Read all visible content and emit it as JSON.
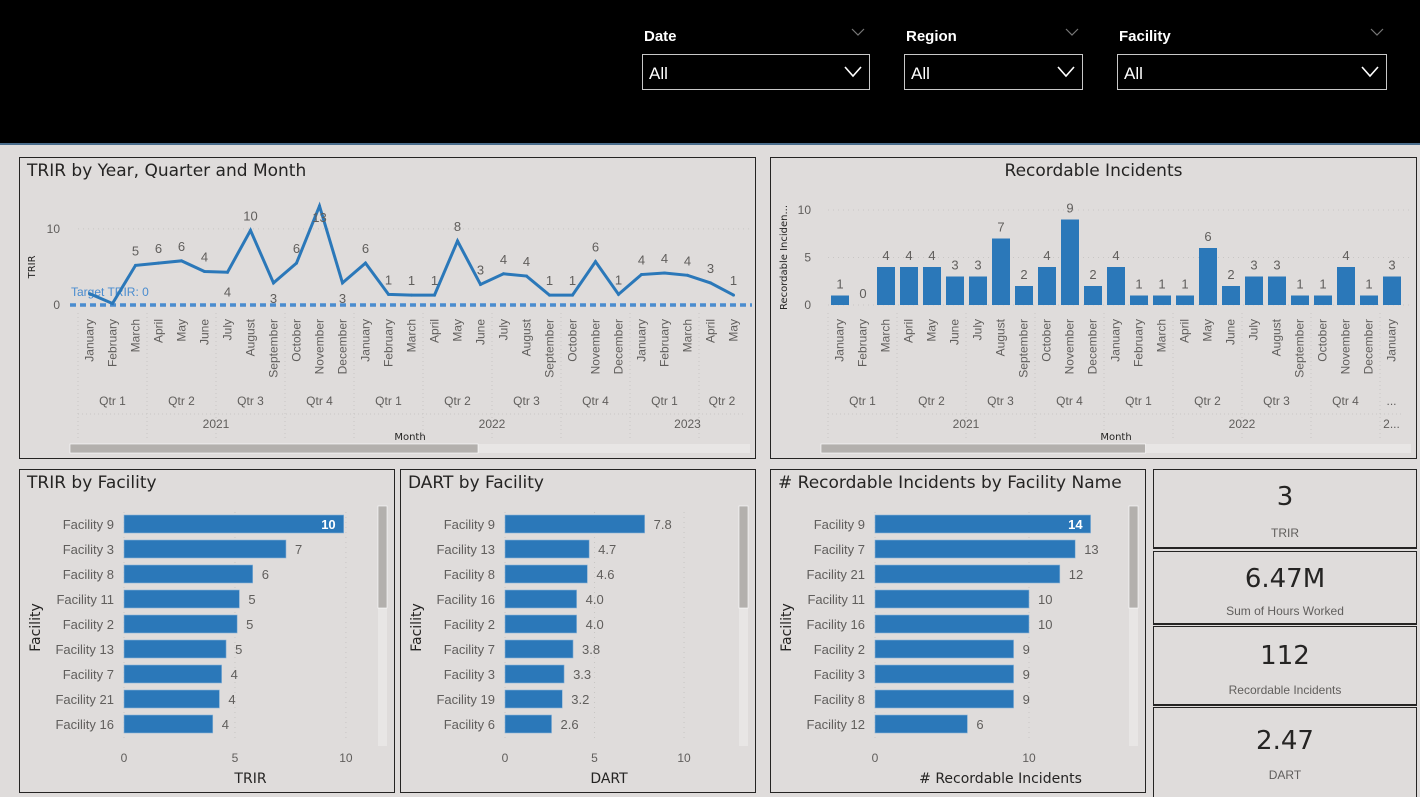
{
  "filters": [
    {
      "label": "Date",
      "value": "All"
    },
    {
      "label": "Region",
      "value": "All"
    },
    {
      "label": "Facility",
      "value": "All"
    }
  ],
  "colors": {
    "bar": "#2b78b9",
    "line": "#2b78b9",
    "target": "#4a8ccf",
    "panel_bg": "#dfdcdb",
    "header_bg": "#000000"
  },
  "trir_trend": {
    "title": "TRIR by Year, Quarter and Month",
    "ylabel": "TRIR",
    "xlabel": "Month",
    "target_label": "Target TRIR: 0",
    "scroll_fraction": 0.6
  },
  "incidents_trend": {
    "title": "Recordable Incidents",
    "ylabel": "Recordable Inciden...",
    "xlabel": "Month",
    "scroll_fraction": 0.55
  },
  "trir_facility": {
    "title": "TRIR by Facility",
    "xlabel": "TRIR",
    "ylabel": "Facility"
  },
  "dart_facility": {
    "title": "DART by Facility",
    "xlabel": "DART",
    "ylabel": "Facility"
  },
  "incidents_facility": {
    "title": "# Recordable Incidents by Facility Name",
    "xlabel": "# Recordable Incidents",
    "ylabel": "Facility"
  },
  "cards": [
    {
      "value": "3",
      "label": "TRIR"
    },
    {
      "value": "6.47M",
      "label": "Sum of  Hours Worked"
    },
    {
      "value": "112",
      "label": "Recordable Incidents"
    },
    {
      "value": "2.47",
      "label": "DART"
    }
  ],
  "chart_data": [
    {
      "type": "line",
      "title": "TRIR by Year, Quarter and Month",
      "xlabel": "Month",
      "ylabel": "TRIR",
      "ylim": [
        0,
        13
      ],
      "yticks": [
        0,
        10
      ],
      "x": [
        "January",
        "February",
        "March",
        "April",
        "May",
        "June",
        "July",
        "August",
        "September",
        "October",
        "November",
        "December",
        "January",
        "February",
        "March",
        "April",
        "May",
        "June",
        "July",
        "August",
        "September",
        "October",
        "November",
        "December",
        "January",
        "February",
        "March",
        "April",
        "May"
      ],
      "quarters": [
        {
          "label": "Qtr 1",
          "span": 3
        },
        {
          "label": "Qtr 2",
          "span": 3
        },
        {
          "label": "Qtr 3",
          "span": 3
        },
        {
          "label": "Qtr 4",
          "span": 3
        },
        {
          "label": "Qtr 1",
          "span": 3
        },
        {
          "label": "Qtr 2",
          "span": 3
        },
        {
          "label": "Qtr 3",
          "span": 3
        },
        {
          "label": "Qtr 4",
          "span": 3
        },
        {
          "label": "Qtr 1",
          "span": 3
        },
        {
          "label": "Qtr 2",
          "span": 2
        }
      ],
      "years": [
        {
          "label": "2021",
          "span": 12
        },
        {
          "label": "2022",
          "span": 12
        },
        {
          "label": "2023",
          "span": 5
        }
      ],
      "values": [
        1.5,
        0.2,
        5.2,
        5.5,
        5.8,
        4.4,
        4.3,
        9.8,
        2.9,
        5.5,
        13,
        2.9,
        5.5,
        1.4,
        1.3,
        1.3,
        8.4,
        2.7,
        4.1,
        3.8,
        1.3,
        1.3,
        5.7,
        1.4,
        4.0,
        4.2,
        3.9,
        2.9,
        1.3
      ],
      "labels": [
        "",
        "",
        "5",
        "6",
        "6",
        "4",
        "4",
        "10",
        "3",
        "6",
        "13",
        "3",
        "6",
        "1",
        "1",
        "1",
        "8",
        "3",
        "4",
        "4",
        "1",
        "1",
        "6",
        "1",
        "4",
        "4",
        "4",
        "3",
        "1"
      ],
      "target": {
        "label": "Target TRIR: 0",
        "value": 0
      }
    },
    {
      "type": "bar",
      "title": "Recordable Incidents",
      "xlabel": "Month",
      "ylabel": "Recordable Inciden...",
      "ylim": [
        0,
        10
      ],
      "yticks": [
        0,
        5,
        10
      ],
      "categories": [
        "January",
        "February",
        "March",
        "April",
        "May",
        "June",
        "July",
        "August",
        "September",
        "October",
        "November",
        "December",
        "January",
        "February",
        "March",
        "April",
        "May",
        "June",
        "July",
        "August",
        "September",
        "October",
        "November",
        "December",
        "January"
      ],
      "quarters": [
        {
          "label": "Qtr 1",
          "span": 3
        },
        {
          "label": "Qtr 2",
          "span": 3
        },
        {
          "label": "Qtr 3",
          "span": 3
        },
        {
          "label": "Qtr 4",
          "span": 3
        },
        {
          "label": "Qtr 1",
          "span": 3
        },
        {
          "label": "Qtr 2",
          "span": 3
        },
        {
          "label": "Qtr 3",
          "span": 3
        },
        {
          "label": "Qtr 4",
          "span": 3
        },
        {
          "label": "...",
          "span": 1
        }
      ],
      "years": [
        {
          "label": "2021",
          "span": 12
        },
        {
          "label": "2022",
          "span": 12
        },
        {
          "label": "2...",
          "span": 1
        }
      ],
      "values": [
        1,
        0,
        4,
        4,
        4,
        3,
        3,
        7,
        2,
        4,
        9,
        2,
        4,
        1,
        1,
        1,
        6,
        2,
        3,
        3,
        1,
        1,
        4,
        1,
        3
      ]
    },
    {
      "type": "bar",
      "orientation": "horizontal",
      "title": "TRIR by Facility",
      "xlabel": "TRIR",
      "ylabel": "Facility",
      "xlim": [
        0,
        10.5
      ],
      "xticks": [
        0,
        5,
        10
      ],
      "categories": [
        "Facility 9",
        "Facility 3",
        "Facility 8",
        "Facility 11",
        "Facility 2",
        "Facility 13",
        "Facility 7",
        "Facility 21",
        "Facility 16"
      ],
      "values": [
        9.9,
        7.3,
        5.8,
        5.2,
        5.1,
        4.6,
        4.4,
        4.3,
        4.0
      ],
      "labels": [
        "10",
        "7",
        "6",
        "5",
        "5",
        "5",
        "4",
        "4",
        "4"
      ]
    },
    {
      "type": "bar",
      "orientation": "horizontal",
      "title": "DART by Facility",
      "xlabel": "DART",
      "ylabel": "Facility",
      "xlim": [
        0,
        10.5
      ],
      "xticks": [
        0,
        5,
        10
      ],
      "categories": [
        "Facility 9",
        "Facility 13",
        "Facility 8",
        "Facility 16",
        "Facility 2",
        "Facility 7",
        "Facility 3",
        "Facility 19",
        "Facility 6"
      ],
      "values": [
        7.8,
        4.7,
        4.6,
        4.0,
        4.0,
        3.8,
        3.3,
        3.2,
        2.6
      ],
      "labels": [
        "7.8",
        "4.7",
        "4.6",
        "4.0",
        "4.0",
        "3.8",
        "3.3",
        "3.2",
        "2.6"
      ]
    },
    {
      "type": "bar",
      "orientation": "horizontal",
      "title": "# Recordable Incidents by Facility Name",
      "xlabel": "# Recordable Incidents",
      "ylabel": "Facility",
      "xlim": [
        0,
        15
      ],
      "xticks": [
        0,
        10
      ],
      "categories": [
        "Facility 9",
        "Facility 7",
        "Facility 21",
        "Facility 11",
        "Facility 16",
        "Facility 2",
        "Facility 3",
        "Facility 8",
        "Facility 12"
      ],
      "values": [
        14,
        13,
        12,
        10,
        10,
        9,
        9,
        9,
        6
      ],
      "labels": [
        "14",
        "13",
        "12",
        "10",
        "10",
        "9",
        "9",
        "9",
        "6"
      ]
    }
  ]
}
